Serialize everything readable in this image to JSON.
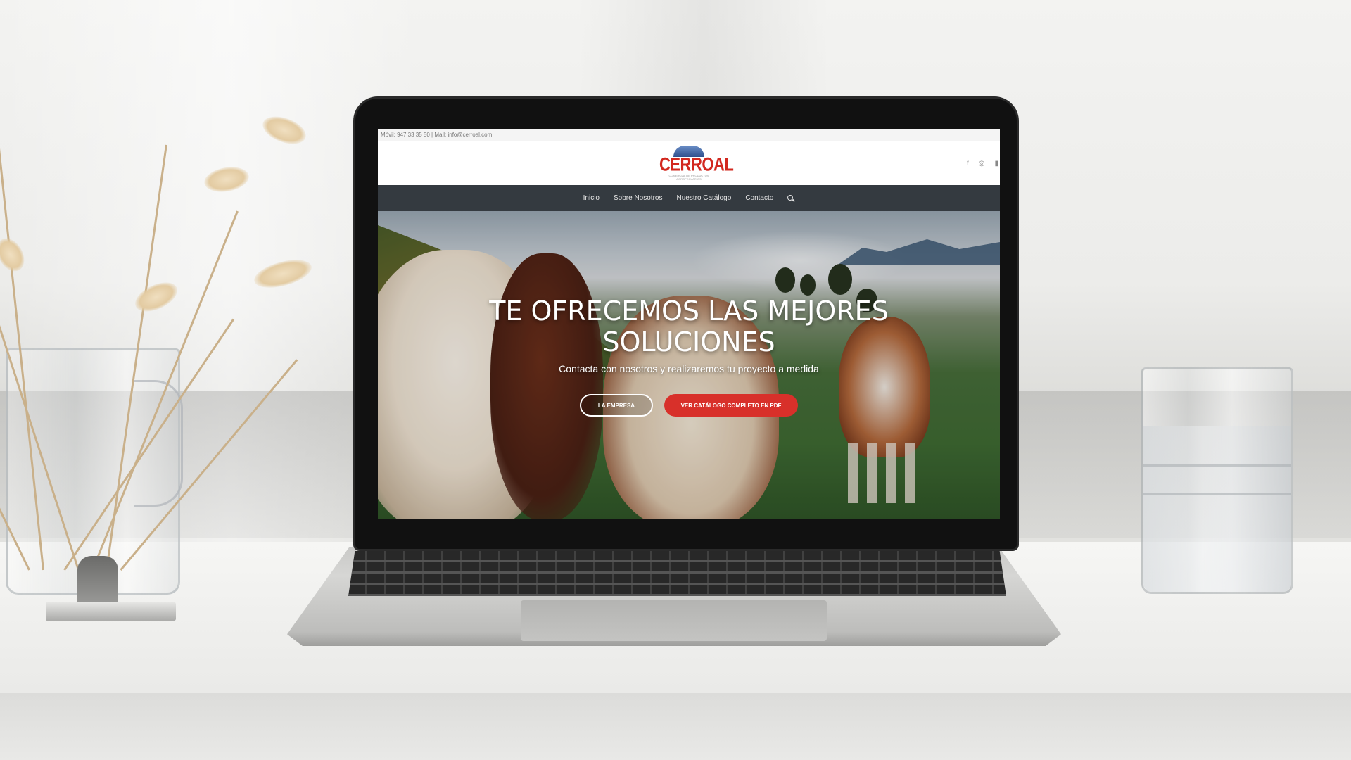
{
  "website": {
    "topbar_text": "Móvil: 947 33 35 50 | Mail: info@cerroal.com",
    "logo": {
      "name": "CERROAL",
      "tagline": "COMERCIAL DE PRODUCTOS AGROPECUARIOS"
    },
    "social_icons": [
      "facebook-icon",
      "instagram-icon",
      "linkedin-icon"
    ],
    "nav": {
      "items": [
        "Inicio",
        "Sobre Nosotros",
        "Nuestro Catálogo",
        "Contacto"
      ],
      "search_icon": "search-icon"
    },
    "hero": {
      "title": "TE OFRECEMOS LAS MEJORES SOLUCIONES",
      "subtitle": "Contacta con nosotros y realizaremos tu proyecto a medida",
      "buttons": [
        "LA EMPRESA",
        "VER CATÁLOGO COMPLETO EN PDF"
      ]
    }
  },
  "colors": {
    "brand_red": "#d8302a",
    "nav_bg": "#343a40",
    "logo_blue": "#2e4f8d"
  }
}
